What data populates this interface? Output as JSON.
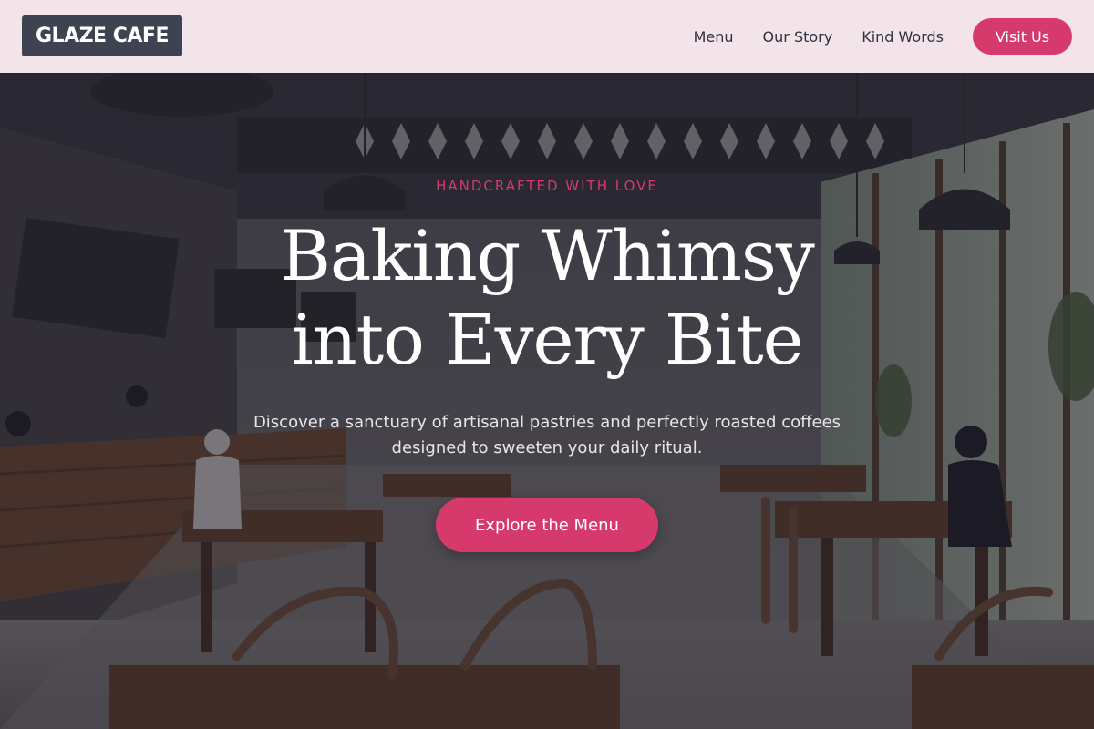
{
  "header": {
    "logo_text": "GLAZE CAFE",
    "nav": [
      {
        "label": "Menu"
      },
      {
        "label": "Our Story"
      },
      {
        "label": "Kind Words"
      }
    ],
    "visit_button_label": "Visit Us"
  },
  "hero": {
    "eyebrow": "HANDCRAFTED WITH LOVE",
    "headline_line1": "Baking Whimsy",
    "headline_line2": "into Every Bite",
    "subtitle": "Discover a sanctuary of artisanal pastries and perfectly roasted coffees designed to sweeten your daily ritual.",
    "cta_label": "Explore the Menu",
    "background_image": "cafe-interior-photo"
  },
  "colors": {
    "accent": "#d63a6c",
    "header_bg": "#f3e4ea",
    "logo_bg": "#3d4350",
    "nav_text": "#2f3340",
    "hero_text": "#ffffff"
  }
}
